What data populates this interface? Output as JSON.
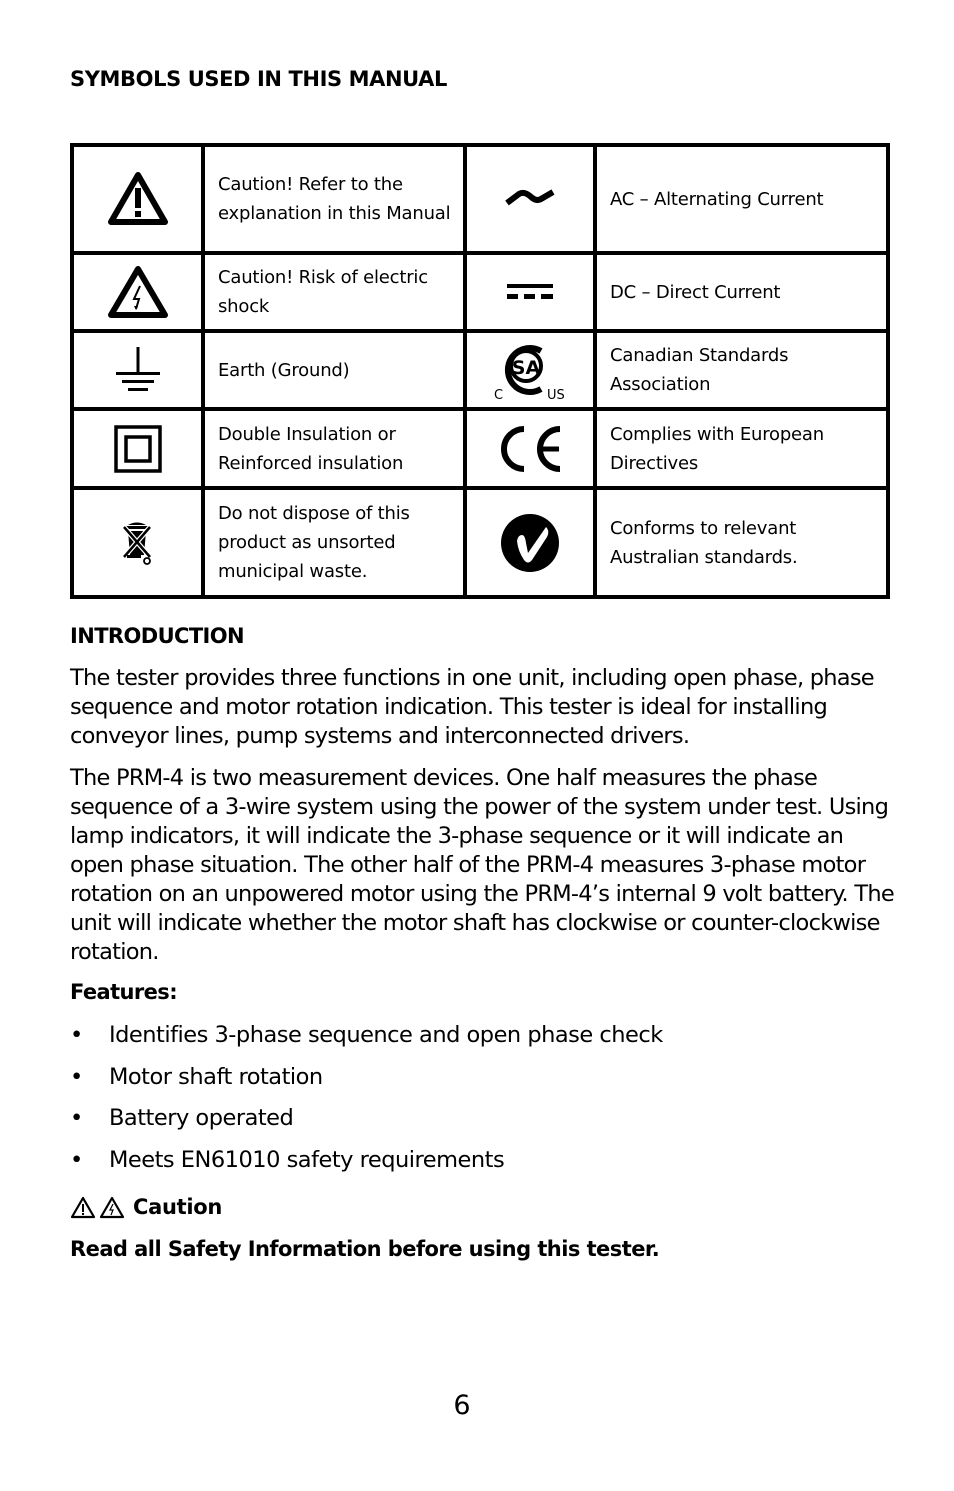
{
  "symbols_section": {
    "title": "SYMBOLS USED IN THIS MANUAL",
    "rows": [
      {
        "left": {
          "icon": "caution-warning-triangle-icon",
          "description": "Caution! Refer to the explanation in this Manual"
        },
        "right": {
          "icon": "ac-tilde-icon",
          "description": "AC – Alternating Current"
        }
      },
      {
        "left": {
          "icon": "electric-shock-triangle-icon",
          "description": "Caution! Risk of electric shock"
        },
        "right": {
          "icon": "dc-direct-current-icon",
          "description": "DC – Direct Current"
        }
      },
      {
        "left": {
          "icon": "earth-ground-icon",
          "description": "Earth (Ground)"
        },
        "right": {
          "icon": "csa-mark-icon",
          "description": "Canadian Standards Association",
          "icon_text": {
            "mark": "SA",
            "left": "C",
            "right": "US"
          }
        }
      },
      {
        "left": {
          "icon": "double-insulation-icon",
          "description": "Double Insulation or Reinforced insulation"
        },
        "right": {
          "icon": "ce-mark-icon",
          "description": "Complies with European Directives"
        }
      },
      {
        "left": {
          "icon": "weee-crossed-bin-icon",
          "description": "Do not dispose of this product as unsorted municipal waste."
        },
        "right": {
          "icon": "c-tick-mark-icon",
          "description": "Conforms to relevant Australian standards."
        }
      }
    ]
  },
  "introduction": {
    "heading": "INTRODUCTION",
    "paragraphs": [
      "The tester provides three functions in one unit, including open phase, phase sequence and motor rotation indication. This tester is ideal for installing conveyor lines, pump systems and interconnected drivers.",
      "The PRM-4 is two measurement devices. One half measures the phase sequence of a 3-wire system using the power of the system under test. Using lamp indicators, it will indicate the 3-phase sequence or it will indicate an open phase situation. The other half of the PRM-4 measures 3-phase motor rotation on an unpowered motor using the PRM-4’s internal 9 volt battery. The unit will indicate whether the motor shaft has clockwise or counter-clockwise rotation."
    ],
    "features_heading": "Features:",
    "bullet": "•",
    "features": [
      "Identifies 3-phase sequence and open phase check",
      "Motor shaft rotation",
      "Battery operated",
      "Meets EN61010 safety requirements"
    ]
  },
  "caution": {
    "label": "Caution",
    "icons": [
      "caution-warning-triangle-icon",
      "electric-shock-triangle-icon"
    ],
    "message": "Read all Safety Information before using this tester."
  },
  "page_number": "6"
}
